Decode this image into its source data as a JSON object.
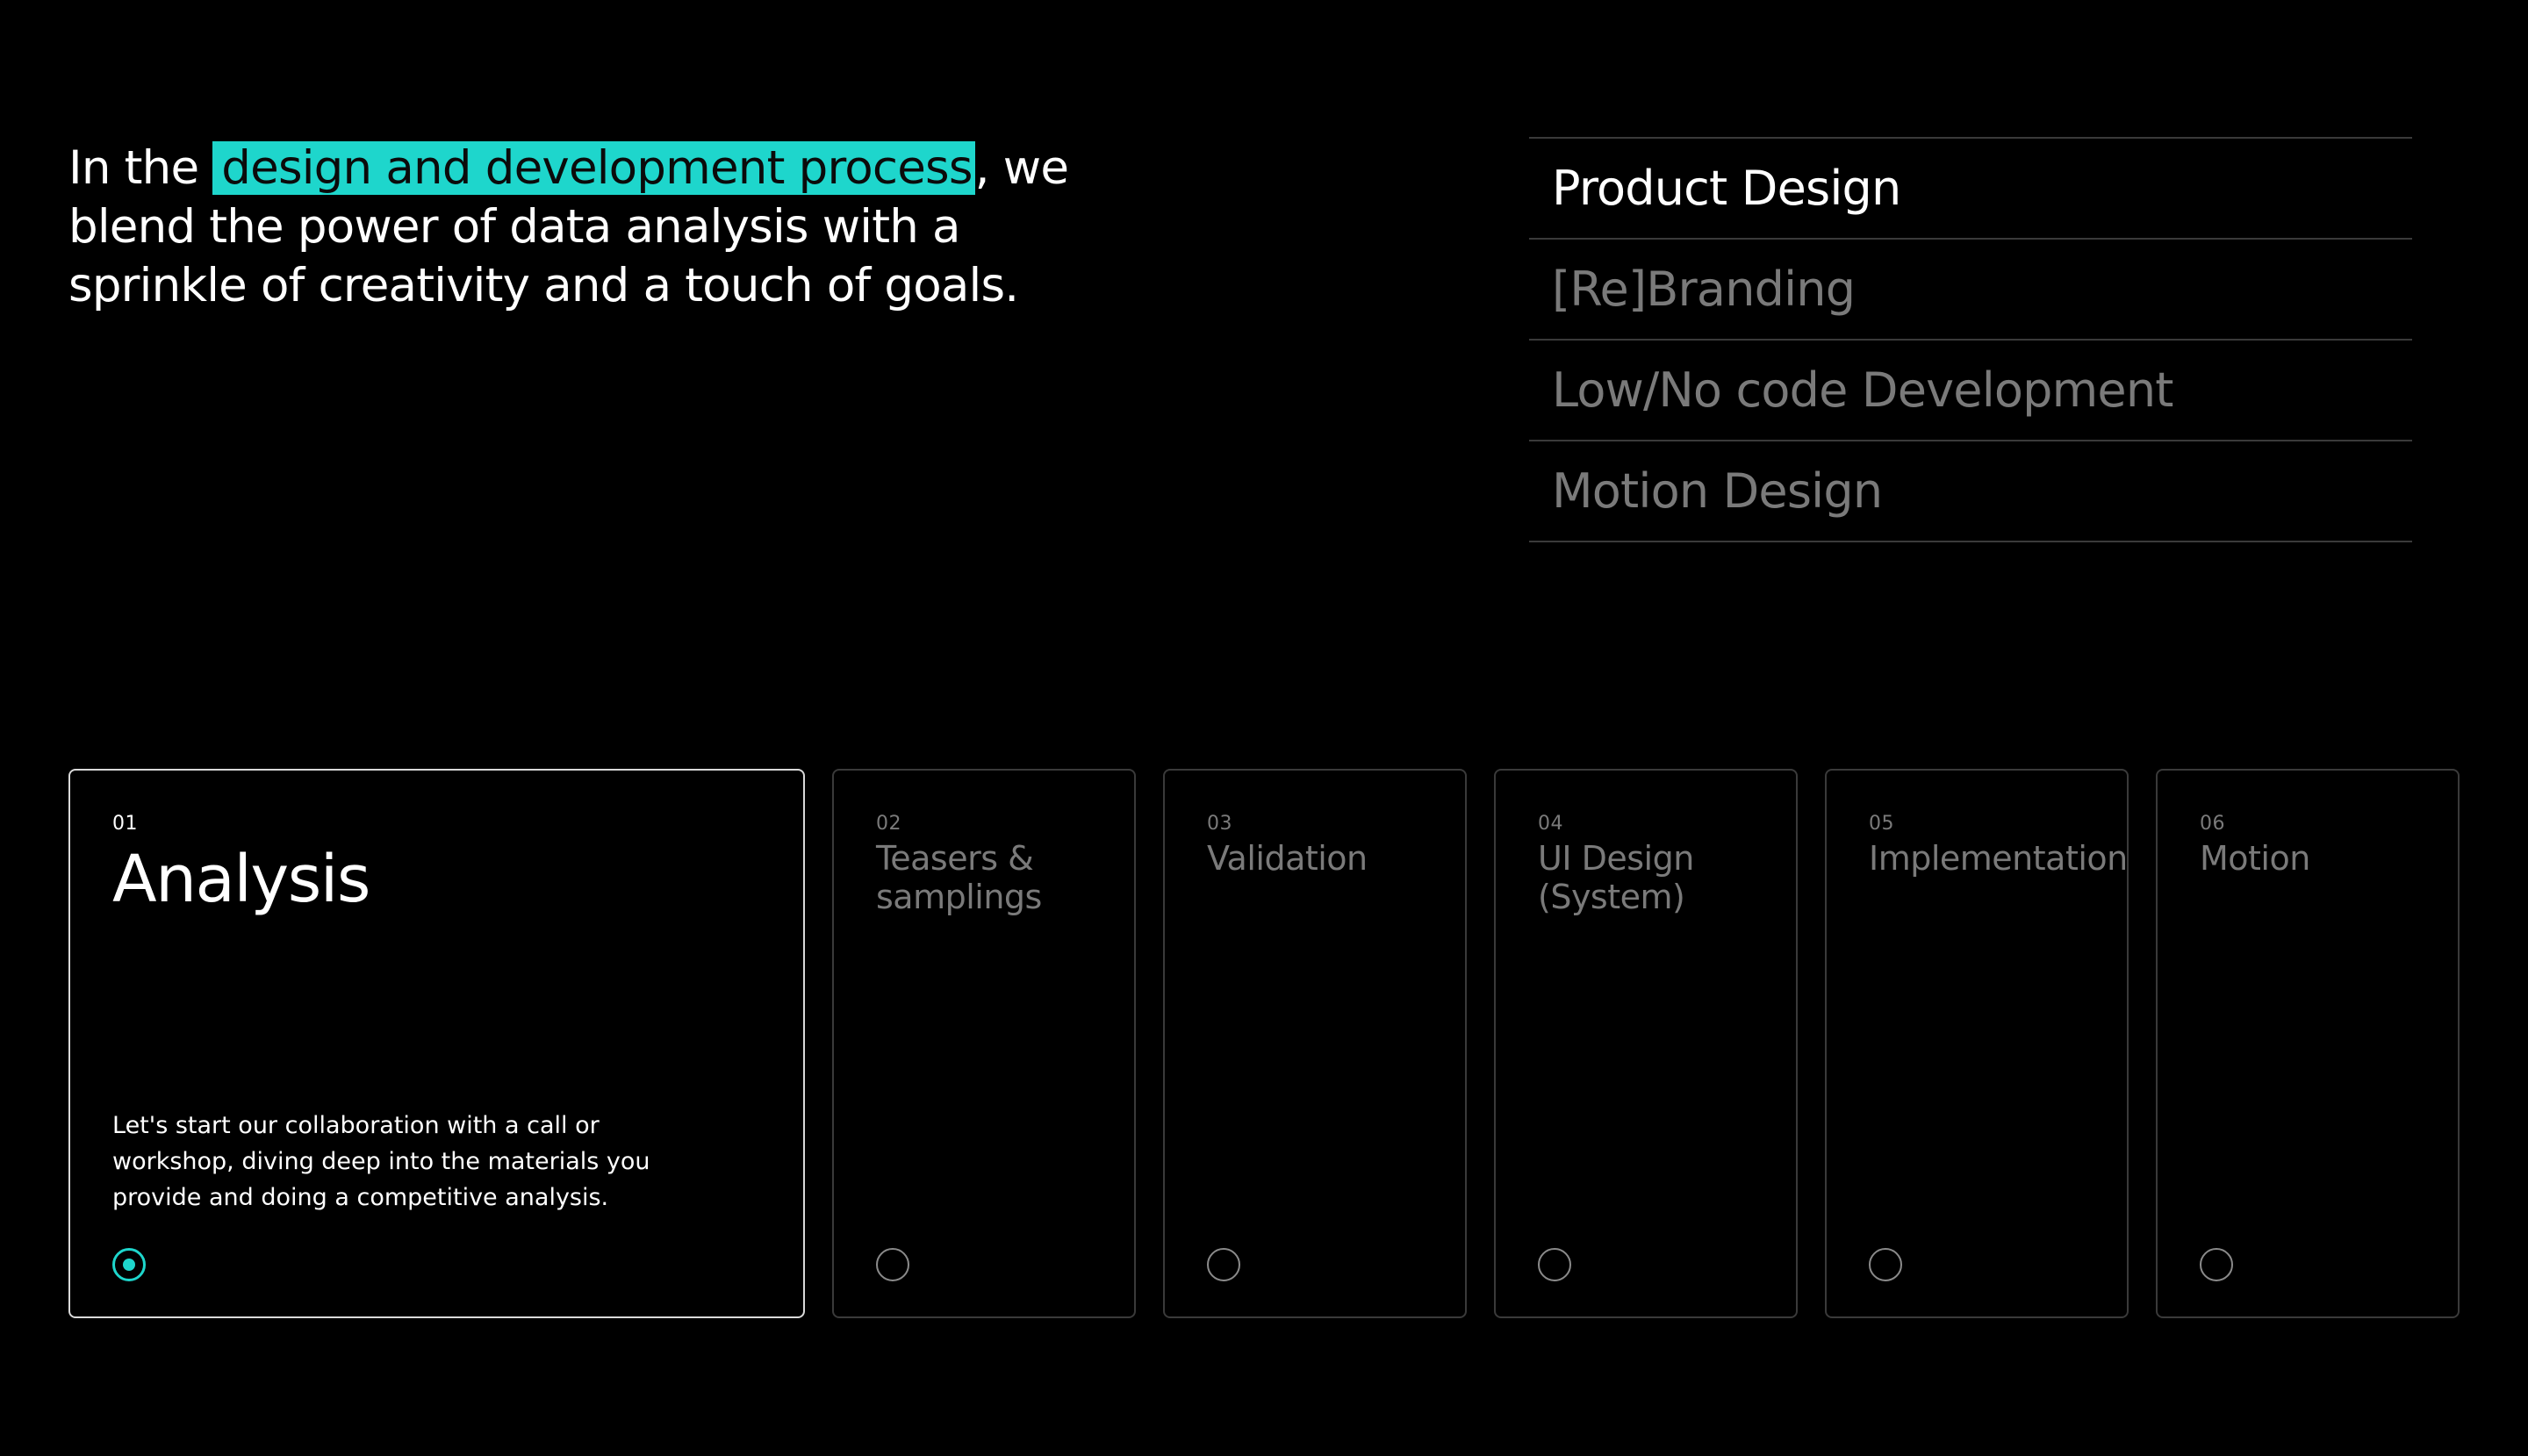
{
  "intro": {
    "before": "In the ",
    "highlight": "design and development process",
    "after": ", we blend the power of data analysis with a sprinkle of creativity and a touch of goals."
  },
  "services": [
    {
      "label": "Product Design",
      "active": true
    },
    {
      "label": "[Re]Branding",
      "active": false
    },
    {
      "label": "Low/No code Development",
      "active": false
    },
    {
      "label": "Motion Design",
      "active": false
    }
  ],
  "steps": [
    {
      "number": "01",
      "title": "Analysis",
      "description": "Let's start our collaboration with a call or workshop, diving deep into the materials you provide and doing a competitive analysis.",
      "active": true
    },
    {
      "number": "02",
      "title": "Teasers & samplings",
      "active": false
    },
    {
      "number": "03",
      "title": "Validation",
      "active": false
    },
    {
      "number": "04",
      "title": "UI Design (System)",
      "active": false
    },
    {
      "number": "05",
      "title": "Implementation",
      "active": false
    },
    {
      "number": "06",
      "title": "Motion",
      "active": false
    }
  ],
  "colors": {
    "background": "#000000",
    "accent": "#1ed6cc",
    "text": "#ffffff",
    "muted_text": "#7a7a7a",
    "border": "#3a3a3a"
  }
}
